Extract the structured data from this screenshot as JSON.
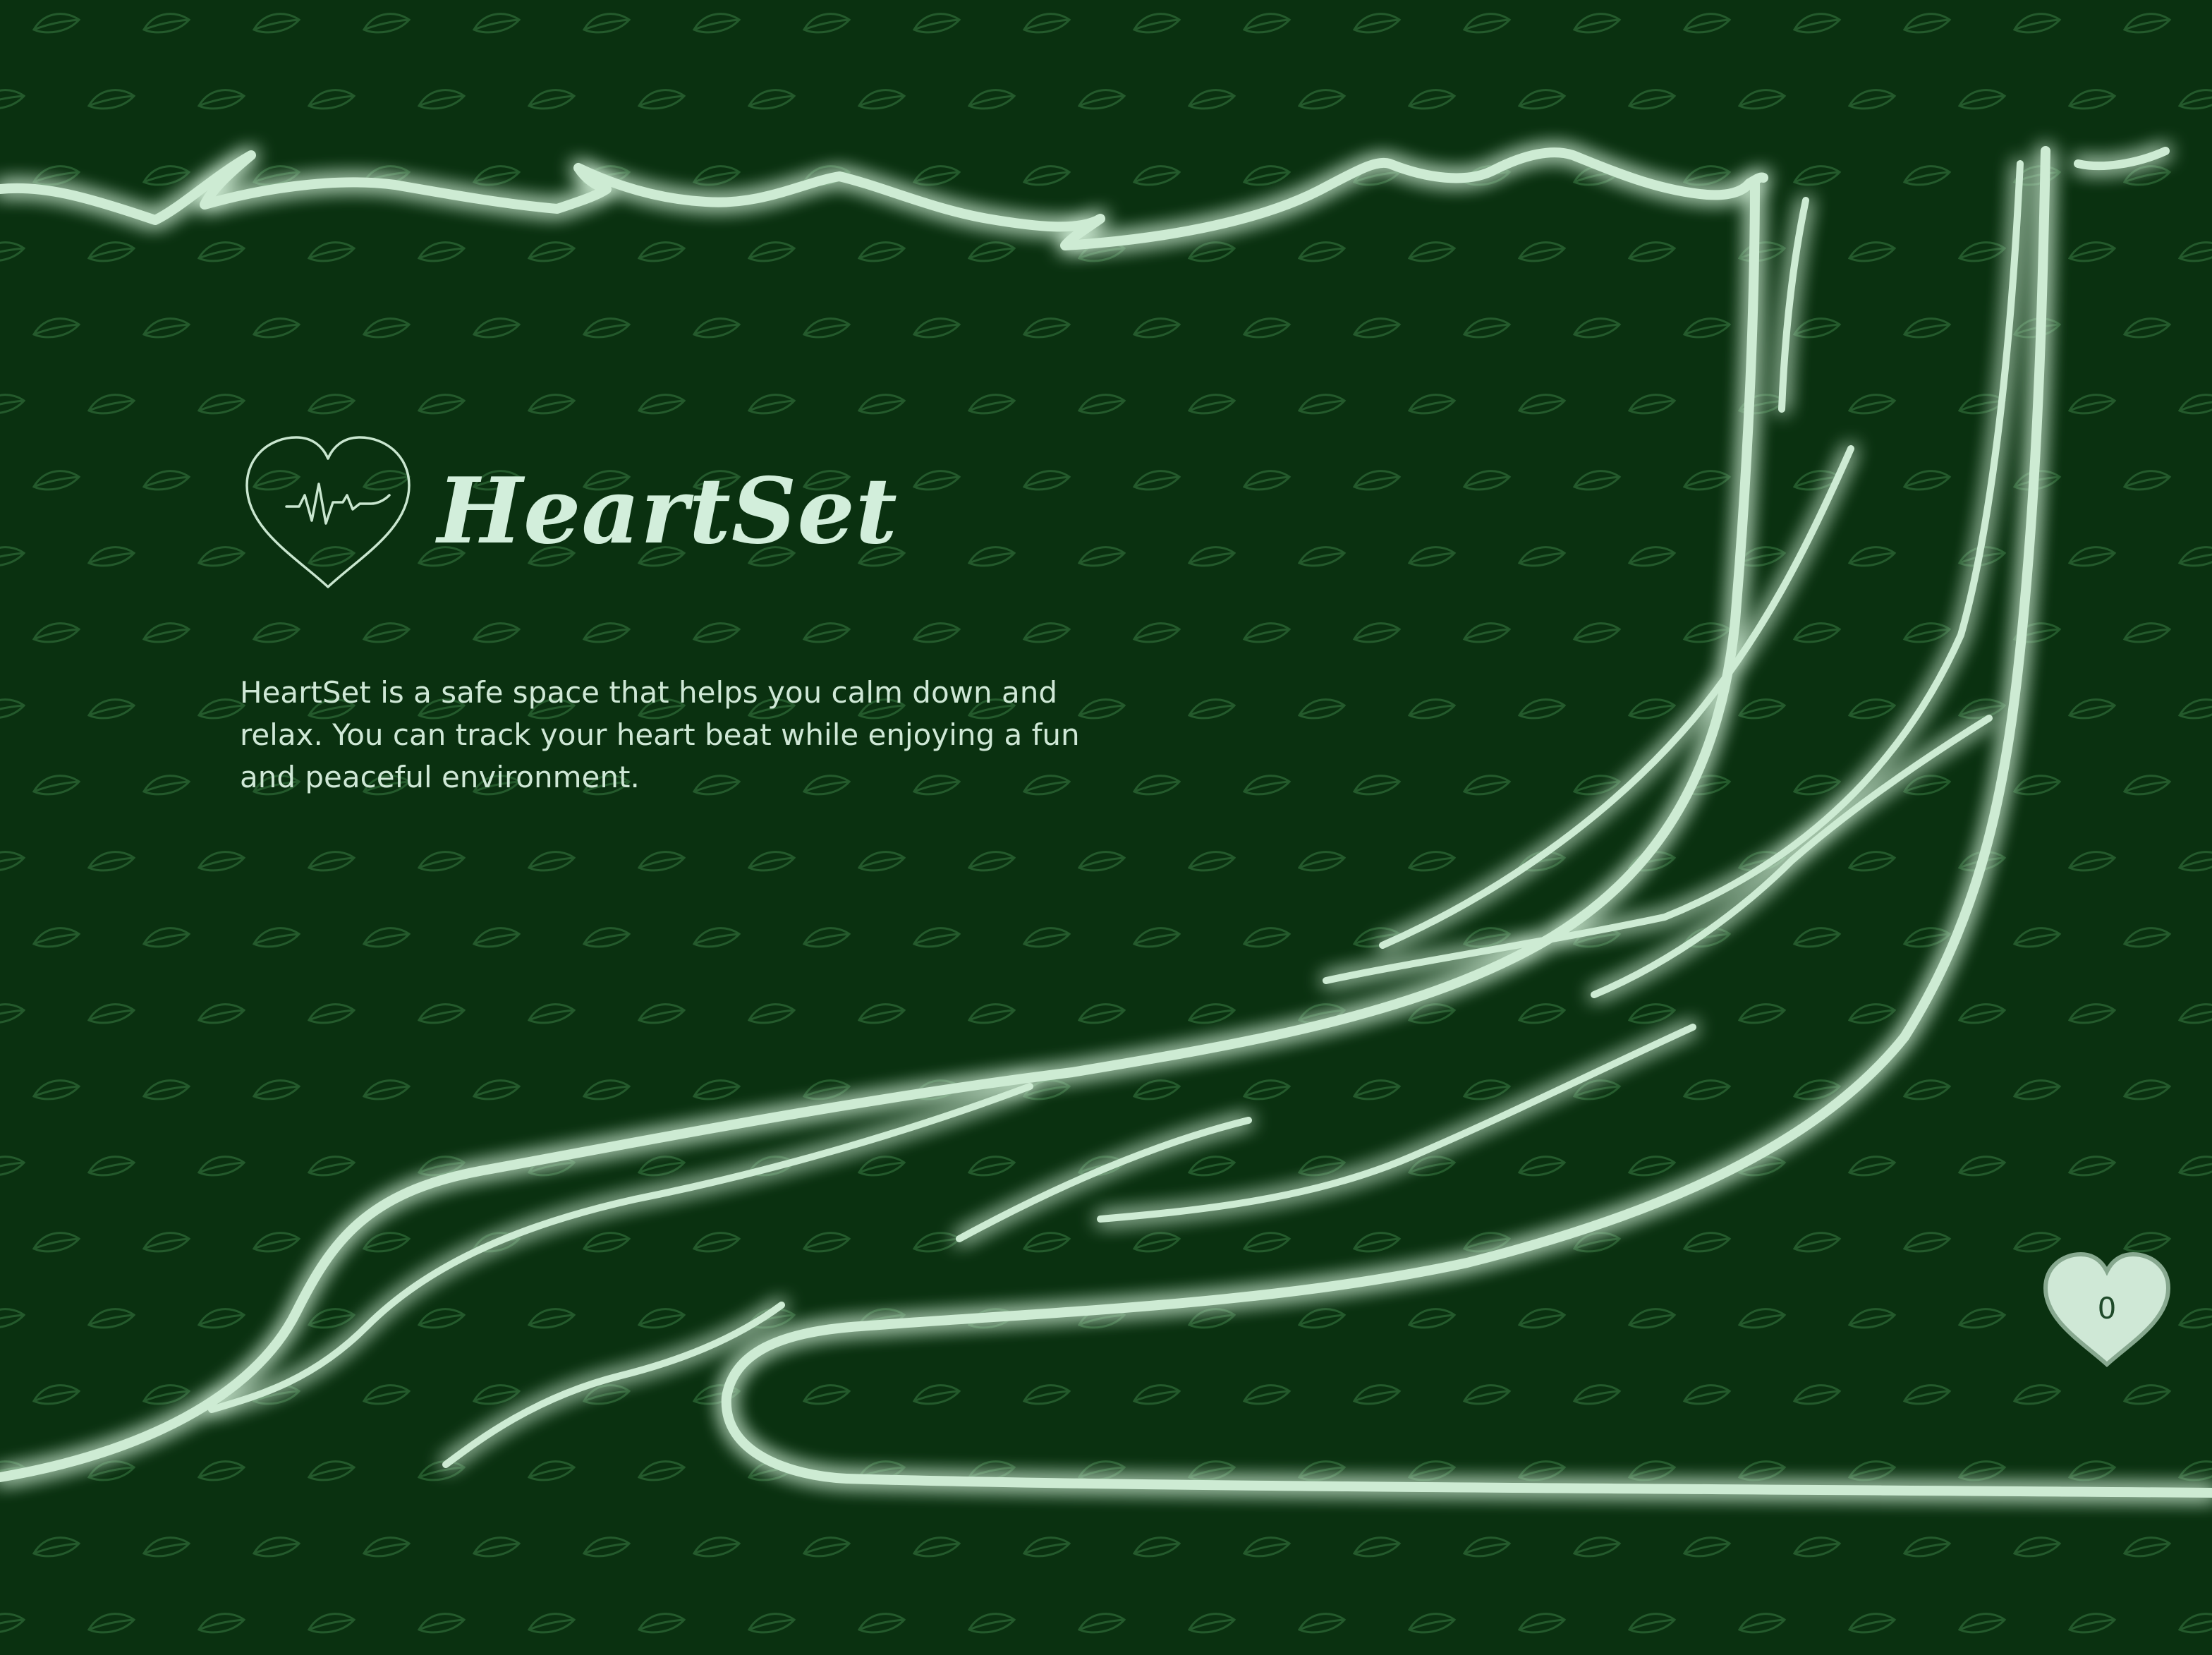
{
  "app": {
    "title": "HeartSet",
    "description": "HeartSet is a safe space that helps you calm down and relax. You can track your heart beat while enjoying a fun and peaceful environment."
  },
  "heart_counter": {
    "value": "0"
  },
  "colors": {
    "background": "#0a3110",
    "line": "#cdebd3",
    "glow": "#bff0c8",
    "leaf_pattern": "#245a2c",
    "heart_fill": "#cfe8d6",
    "heart_stroke": "#87a88f"
  },
  "icons": {
    "logo": "heart-pulse-icon",
    "background_pattern": "leaf-icon",
    "counter": "heart-icon"
  }
}
